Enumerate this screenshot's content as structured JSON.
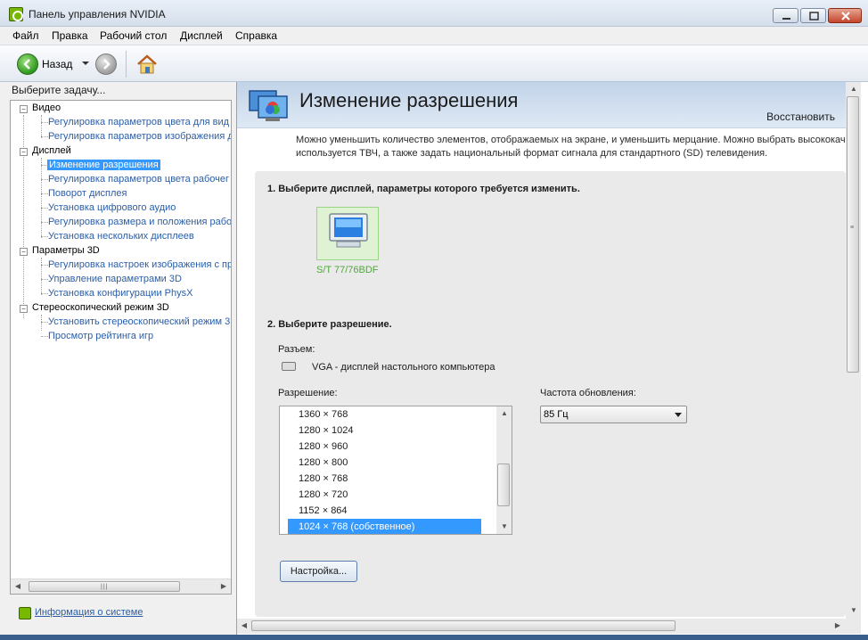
{
  "window": {
    "title": "Панель управления NVIDIA",
    "icon": "nvidia-logo-icon"
  },
  "menu": {
    "items": [
      "Файл",
      "Правка",
      "Рабочий стол",
      "Дисплей",
      "Справка"
    ]
  },
  "toolbar": {
    "back_label": "Назад"
  },
  "left": {
    "task_label": "Выберите задачу...",
    "tree": [
      {
        "label": "Видео",
        "items": [
          "Регулировка параметров цвета для вид",
          "Регулировка параметров изображения д"
        ]
      },
      {
        "label": "Дисплей",
        "items": [
          "Изменение разрешения",
          "Регулировка параметров цвета рабочег",
          "Поворот дисплея",
          "Установка цифрового аудио",
          "Регулировка размера и положения рабо",
          "Установка нескольких дисплеев"
        ]
      },
      {
        "label": "Параметры 3D",
        "items": [
          "Регулировка настроек изображения с пр",
          "Управление параметрами 3D",
          "Установка конфигурации PhysX"
        ]
      },
      {
        "label": "Стереоскопический режим 3D",
        "items": [
          "Установить стереоскопический режим 3",
          "Просмотр рейтинга игр"
        ]
      }
    ],
    "selected_item": "Изменение разрешения",
    "system_info_link": "Информация о системе"
  },
  "main": {
    "title": "Изменение разрешения",
    "restore_link": "Восстановить",
    "description_line1": "Можно уменьшить количество элементов, отображаемых на экране, и уменьшить мерцание. Можно выбрать высококач",
    "description_line2": "используется ТВЧ, а также задать национальный формат сигнала для стандартного (SD) телевидения.",
    "step1": "1. Выберите дисплей, параметры которого требуется изменить.",
    "display_name": "S/T 77/76BDF",
    "step2": "2. Выберите разрешение.",
    "connector_label": "Разъем:",
    "connector_value": "VGA - дисплей настольного компьютера",
    "resolution_label": "Разрешение:",
    "resolutions": [
      "1360 × 768",
      "1280 × 1024",
      "1280 × 960",
      "1280 × 800",
      "1280 × 768",
      "1280 × 720",
      "1152 × 864",
      "1024 × 768 (собственное)"
    ],
    "selected_resolution": "1024 × 768 (собственное)",
    "refresh_label": "Частота обновления:",
    "refresh_value": "85 Гц",
    "settings_button": "Настройка..."
  },
  "colors": {
    "accent": "#3399ff",
    "link": "#2a5ea8",
    "nvidia_green": "#76b900"
  }
}
